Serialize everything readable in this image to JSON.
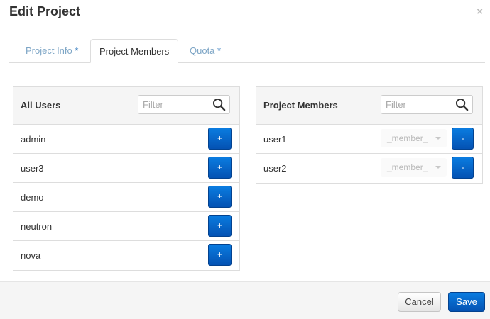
{
  "modal": {
    "title": "Edit Project",
    "close_label": "×"
  },
  "tabs": [
    {
      "label": "Project Info",
      "required_mark": "*",
      "active": false
    },
    {
      "label": "Project Members",
      "required_mark": "",
      "active": true
    },
    {
      "label": "Quota",
      "required_mark": "*",
      "active": false
    }
  ],
  "all_users": {
    "title": "All Users",
    "filter_placeholder": "Filter",
    "filter_value": "",
    "items": [
      {
        "name": "admin",
        "action_label": "+"
      },
      {
        "name": "user3",
        "action_label": "+"
      },
      {
        "name": "demo",
        "action_label": "+"
      },
      {
        "name": "neutron",
        "action_label": "+"
      },
      {
        "name": "nova",
        "action_label": "+"
      }
    ]
  },
  "project_members": {
    "title": "Project Members",
    "filter_placeholder": "Filter",
    "filter_value": "",
    "items": [
      {
        "name": "user1",
        "role": "_member_",
        "action_label": "-"
      },
      {
        "name": "user2",
        "role": "_member_",
        "action_label": "-"
      }
    ]
  },
  "footer": {
    "cancel_label": "Cancel",
    "save_label": "Save"
  },
  "colors": {
    "primary": "#0567c8",
    "tab_inactive": "#7ea6c6",
    "panel_bg": "#f5f5f5",
    "border": "#dddddd"
  },
  "icons": {
    "filter": "search-icon",
    "close": "close-icon",
    "role_dropdown": "caret-down-icon"
  }
}
